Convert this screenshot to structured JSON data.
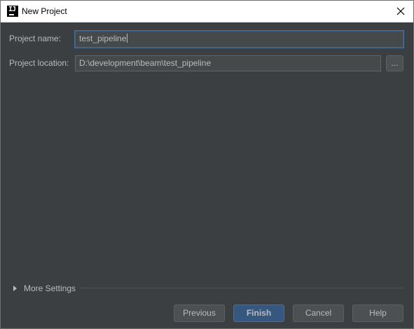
{
  "window": {
    "title": "New Project",
    "app_icon": "intellij-idea-icon",
    "close_icon": "close-icon"
  },
  "form": {
    "project_name_label": "Project name:",
    "project_name_value": "test_pipeline",
    "project_location_label": "Project location:",
    "project_location_value": "D:\\development\\beam\\test_pipeline",
    "browse_label": "..."
  },
  "more_settings": {
    "label": "More Settings",
    "expanded": false,
    "icon": "triangle-right-icon"
  },
  "buttons": {
    "previous": "Previous",
    "finish": "Finish",
    "cancel": "Cancel",
    "help": "Help"
  },
  "colors": {
    "background": "#3c3f41",
    "field_background": "#45494a",
    "primary_button": "#365880",
    "text": "#bbbbbb",
    "focus_border": "#466d94"
  }
}
